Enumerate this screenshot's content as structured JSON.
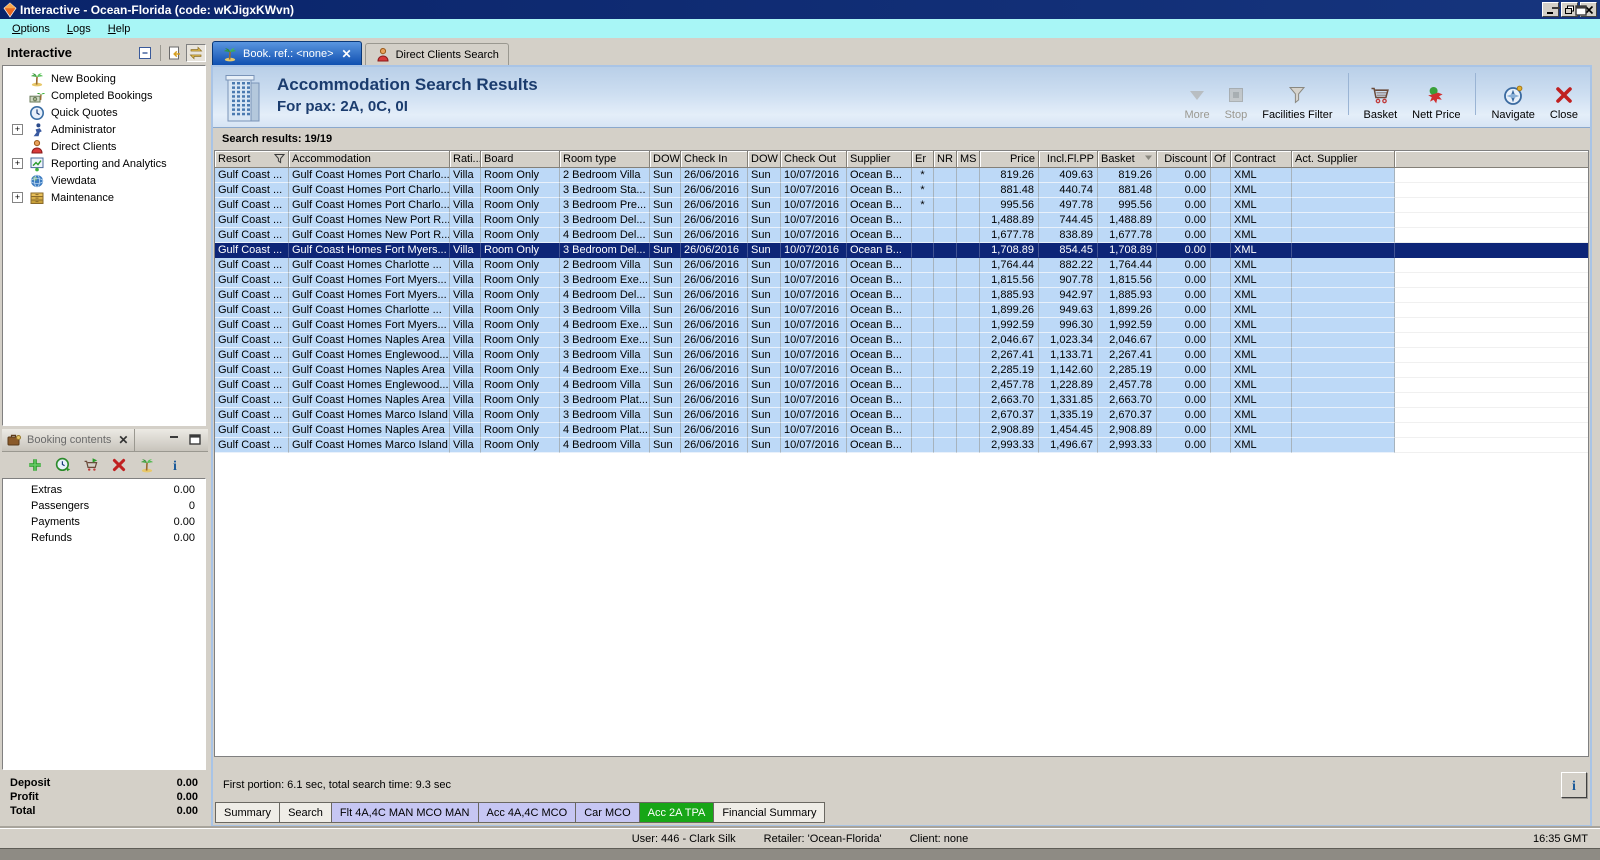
{
  "colors": {
    "titlebar_bg": "#0a246a",
    "menubar_bg": "#a8f6f6",
    "window_bg": "#d4d0c8",
    "result_row_bg": "#bdd9f7",
    "selected_row_bg": "#0d2577",
    "active_tab_top": "#5a96e0",
    "active_tab_bottom": "#0f4fb0",
    "band_top": "#b9cfe8",
    "band_bottom": "#e4eef9",
    "heading_text": "#1b3c6e",
    "green_tab_bg": "#17a617",
    "lavender_tab_bg": "#c6c6f3"
  },
  "window": {
    "title": "Interactive - Ocean-Florida (code: wKJigxKWvn)",
    "buttons": [
      "minimize",
      "restore",
      "close"
    ]
  },
  "menu": {
    "items": [
      "Options",
      "Logs",
      "Help"
    ]
  },
  "sidebar": {
    "title": "Interactive",
    "buttons": [
      {
        "icon": "collapse-box",
        "name": "collapse-panel"
      },
      {
        "icon": "doc-arrow",
        "name": "import-booking"
      },
      {
        "icon": "swap-arrows",
        "name": "swap-panels"
      }
    ],
    "tree": [
      {
        "label": "New Booking",
        "icon": "palm-tree",
        "expandable": false
      },
      {
        "label": "Completed Bookings",
        "icon": "money-palm",
        "expandable": false
      },
      {
        "label": "Quick Quotes",
        "icon": "clock",
        "expandable": false
      },
      {
        "label": "Administrator",
        "icon": "admin-person",
        "expandable": true
      },
      {
        "label": "Direct Clients",
        "icon": "person",
        "expandable": false
      },
      {
        "label": "Reporting and Analytics",
        "icon": "chart-monitor",
        "expandable": true
      },
      {
        "label": "Viewdata",
        "icon": "globe",
        "expandable": false
      },
      {
        "label": "Maintenance",
        "icon": "drawers",
        "expandable": true
      }
    ]
  },
  "booking_contents": {
    "title": "Booking contents",
    "toolbar": [
      {
        "icon": "add-plus",
        "name": "add-item"
      },
      {
        "icon": "quote-clock",
        "name": "quick-quote"
      },
      {
        "icon": "cart-arrow",
        "name": "move-to-basket"
      },
      {
        "icon": "delete-x",
        "name": "delete-item"
      },
      {
        "icon": "palm-tree",
        "name": "new-booking"
      },
      {
        "icon": "info-i",
        "name": "info"
      }
    ],
    "rows": [
      {
        "label": "Extras",
        "value": "0.00"
      },
      {
        "label": "Passengers",
        "value": "0"
      },
      {
        "label": "Payments",
        "value": "0.00"
      },
      {
        "label": "Refunds",
        "value": "0.00"
      }
    ],
    "totals": [
      {
        "label": "Deposit",
        "value": "0.00"
      },
      {
        "label": "Profit",
        "value": "0.00"
      },
      {
        "label": "Total",
        "value": "0.00"
      }
    ]
  },
  "tabs": [
    {
      "label": "Book. ref.: <none>",
      "icon": "palm-tree",
      "active": true,
      "closable": true
    },
    {
      "label": "Direct Clients Search",
      "icon": "person",
      "active": false,
      "closable": false
    }
  ],
  "header": {
    "title": "Accommodation Search Results",
    "subtitle": "For pax: 2A, 0C, 0I",
    "buttons": [
      {
        "label": "More",
        "icon": "more-arrow",
        "disabled": true
      },
      {
        "label": "Stop",
        "icon": "stop-square",
        "disabled": true
      },
      {
        "label": "Facilities Filter",
        "icon": "funnel",
        "disabled": false
      },
      {
        "label": "Basket",
        "icon": "basket-cart",
        "disabled": false,
        "separator_before": true
      },
      {
        "label": "Nett Price",
        "icon": "nett-price",
        "disabled": false
      },
      {
        "label": "Navigate",
        "icon": "compass",
        "disabled": false,
        "separator_before": true
      },
      {
        "label": "Close",
        "icon": "close-x",
        "disabled": false
      }
    ]
  },
  "results": {
    "label": "Search results: 19/19",
    "footer": "First portion: 6.1 sec, total search time: 9.3 sec",
    "selected_index": 5,
    "columns": [
      {
        "label": "Resort",
        "icon": "filter"
      },
      {
        "label": "Accommodation"
      },
      {
        "label": "Rati..."
      },
      {
        "label": "Board"
      },
      {
        "label": "Room type"
      },
      {
        "label": "DOW"
      },
      {
        "label": "Check In"
      },
      {
        "label": "DOW"
      },
      {
        "label": "Check Out"
      },
      {
        "label": "Supplier"
      },
      {
        "label": "Er"
      },
      {
        "label": "NR"
      },
      {
        "label": "MS"
      },
      {
        "label": "Price",
        "align": "right"
      },
      {
        "label": "Incl.Fl.PP",
        "align": "right"
      },
      {
        "label": "Basket",
        "align": "right",
        "icon": "sort"
      },
      {
        "label": "Discount",
        "align": "right"
      },
      {
        "label": "Of"
      },
      {
        "label": "Contract"
      },
      {
        "label": "Act. Supplier"
      }
    ],
    "rows": [
      [
        "Gulf Coast ...",
        "Gulf Coast Homes Port Charlo...",
        "Villa",
        "Room Only",
        "2 Bedroom Villa",
        "Sun",
        "26/06/2016",
        "Sun",
        "10/07/2016",
        "Ocean B...",
        "*",
        "",
        "",
        "819.26",
        "409.63",
        "819.26",
        "0.00",
        "",
        "XML",
        ""
      ],
      [
        "Gulf Coast ...",
        "Gulf Coast Homes Port Charlo...",
        "Villa",
        "Room Only",
        "3 Bedroom Sta...",
        "Sun",
        "26/06/2016",
        "Sun",
        "10/07/2016",
        "Ocean B...",
        "*",
        "",
        "",
        "881.48",
        "440.74",
        "881.48",
        "0.00",
        "",
        "XML",
        ""
      ],
      [
        "Gulf Coast ...",
        "Gulf Coast Homes Port Charlo...",
        "Villa",
        "Room Only",
        "3 Bedroom Pre...",
        "Sun",
        "26/06/2016",
        "Sun",
        "10/07/2016",
        "Ocean B...",
        "*",
        "",
        "",
        "995.56",
        "497.78",
        "995.56",
        "0.00",
        "",
        "XML",
        ""
      ],
      [
        "Gulf Coast ...",
        "Gulf Coast Homes New Port R...",
        "Villa",
        "Room Only",
        "3 Bedroom Del...",
        "Sun",
        "26/06/2016",
        "Sun",
        "10/07/2016",
        "Ocean B...",
        "",
        "",
        "",
        "1,488.89",
        "744.45",
        "1,488.89",
        "0.00",
        "",
        "XML",
        ""
      ],
      [
        "Gulf Coast ...",
        "Gulf Coast Homes New Port R...",
        "Villa",
        "Room Only",
        "4 Bedroom Del...",
        "Sun",
        "26/06/2016",
        "Sun",
        "10/07/2016",
        "Ocean B...",
        "",
        "",
        "",
        "1,677.78",
        "838.89",
        "1,677.78",
        "0.00",
        "",
        "XML",
        ""
      ],
      [
        "Gulf Coast ...",
        "Gulf Coast Homes Fort Myers...",
        "Villa",
        "Room Only",
        "3 Bedroom Del...",
        "Sun",
        "26/06/2016",
        "Sun",
        "10/07/2016",
        "Ocean B...",
        "",
        "",
        "",
        "1,708.89",
        "854.45",
        "1,708.89",
        "0.00",
        "",
        "XML",
        ""
      ],
      [
        "Gulf Coast ...",
        "Gulf Coast Homes Charlotte ...",
        "Villa",
        "Room Only",
        "2 Bedroom Villa",
        "Sun",
        "26/06/2016",
        "Sun",
        "10/07/2016",
        "Ocean B...",
        "",
        "",
        "",
        "1,764.44",
        "882.22",
        "1,764.44",
        "0.00",
        "",
        "XML",
        ""
      ],
      [
        "Gulf Coast ...",
        "Gulf Coast Homes Fort Myers...",
        "Villa",
        "Room Only",
        "3 Bedroom Exe...",
        "Sun",
        "26/06/2016",
        "Sun",
        "10/07/2016",
        "Ocean B...",
        "",
        "",
        "",
        "1,815.56",
        "907.78",
        "1,815.56",
        "0.00",
        "",
        "XML",
        ""
      ],
      [
        "Gulf Coast ...",
        "Gulf Coast Homes Fort Myers...",
        "Villa",
        "Room Only",
        "4 Bedroom Del...",
        "Sun",
        "26/06/2016",
        "Sun",
        "10/07/2016",
        "Ocean B...",
        "",
        "",
        "",
        "1,885.93",
        "942.97",
        "1,885.93",
        "0.00",
        "",
        "XML",
        ""
      ],
      [
        "Gulf Coast ...",
        "Gulf Coast Homes Charlotte ...",
        "Villa",
        "Room Only",
        "3 Bedroom Villa",
        "Sun",
        "26/06/2016",
        "Sun",
        "10/07/2016",
        "Ocean B...",
        "",
        "",
        "",
        "1,899.26",
        "949.63",
        "1,899.26",
        "0.00",
        "",
        "XML",
        ""
      ],
      [
        "Gulf Coast ...",
        "Gulf Coast Homes Fort Myers...",
        "Villa",
        "Room Only",
        "4 Bedroom Exe...",
        "Sun",
        "26/06/2016",
        "Sun",
        "10/07/2016",
        "Ocean B...",
        "",
        "",
        "",
        "1,992.59",
        "996.30",
        "1,992.59",
        "0.00",
        "",
        "XML",
        ""
      ],
      [
        "Gulf Coast ...",
        "Gulf Coast Homes Naples Area",
        "Villa",
        "Room Only",
        "3 Bedroom Exe...",
        "Sun",
        "26/06/2016",
        "Sun",
        "10/07/2016",
        "Ocean B...",
        "",
        "",
        "",
        "2,046.67",
        "1,023.34",
        "2,046.67",
        "0.00",
        "",
        "XML",
        ""
      ],
      [
        "Gulf Coast ...",
        "Gulf Coast Homes Englewood...",
        "Villa",
        "Room Only",
        "3 Bedroom Villa",
        "Sun",
        "26/06/2016",
        "Sun",
        "10/07/2016",
        "Ocean B...",
        "",
        "",
        "",
        "2,267.41",
        "1,133.71",
        "2,267.41",
        "0.00",
        "",
        "XML",
        ""
      ],
      [
        "Gulf Coast ...",
        "Gulf Coast Homes Naples Area",
        "Villa",
        "Room Only",
        "4 Bedroom Exe...",
        "Sun",
        "26/06/2016",
        "Sun",
        "10/07/2016",
        "Ocean B...",
        "",
        "",
        "",
        "2,285.19",
        "1,142.60",
        "2,285.19",
        "0.00",
        "",
        "XML",
        ""
      ],
      [
        "Gulf Coast ...",
        "Gulf Coast Homes Englewood...",
        "Villa",
        "Room Only",
        "4 Bedroom Villa",
        "Sun",
        "26/06/2016",
        "Sun",
        "10/07/2016",
        "Ocean B...",
        "",
        "",
        "",
        "2,457.78",
        "1,228.89",
        "2,457.78",
        "0.00",
        "",
        "XML",
        ""
      ],
      [
        "Gulf Coast ...",
        "Gulf Coast Homes Naples Area",
        "Villa",
        "Room Only",
        "3 Bedroom Plat...",
        "Sun",
        "26/06/2016",
        "Sun",
        "10/07/2016",
        "Ocean B...",
        "",
        "",
        "",
        "2,663.70",
        "1,331.85",
        "2,663.70",
        "0.00",
        "",
        "XML",
        ""
      ],
      [
        "Gulf Coast ...",
        "Gulf Coast Homes Marco Island",
        "Villa",
        "Room Only",
        "3 Bedroom Villa",
        "Sun",
        "26/06/2016",
        "Sun",
        "10/07/2016",
        "Ocean B...",
        "",
        "",
        "",
        "2,670.37",
        "1,335.19",
        "2,670.37",
        "0.00",
        "",
        "XML",
        ""
      ],
      [
        "Gulf Coast ...",
        "Gulf Coast Homes Naples Area",
        "Villa",
        "Room Only",
        "4 Bedroom Plat...",
        "Sun",
        "26/06/2016",
        "Sun",
        "10/07/2016",
        "Ocean B...",
        "",
        "",
        "",
        "2,908.89",
        "1,454.45",
        "2,908.89",
        "0.00",
        "",
        "XML",
        ""
      ],
      [
        "Gulf Coast ...",
        "Gulf Coast Homes Marco Island",
        "Villa",
        "Room Only",
        "4 Bedroom Villa",
        "Sun",
        "26/06/2016",
        "Sun",
        "10/07/2016",
        "Ocean B...",
        "",
        "",
        "",
        "2,993.33",
        "1,496.67",
        "2,993.33",
        "0.00",
        "",
        "XML",
        ""
      ]
    ]
  },
  "bottom_tabs": [
    {
      "label": "Summary",
      "style": "plain"
    },
    {
      "label": "Search",
      "style": "plain"
    },
    {
      "label": "Flt 4A,4C MAN MCO MAN",
      "style": "lavender"
    },
    {
      "label": "Acc 4A,4C MCO",
      "style": "lavender"
    },
    {
      "label": "Car MCO",
      "style": "lavender"
    },
    {
      "label": "Acc 2A TPA",
      "style": "green"
    },
    {
      "label": "Financial Summary",
      "style": "plain"
    }
  ],
  "statusbar": {
    "user": "User: 446 - Clark Silk",
    "retailer": "Retailer: 'Ocean-Florida'",
    "client": "Client: none",
    "time": "16:35 GMT"
  }
}
